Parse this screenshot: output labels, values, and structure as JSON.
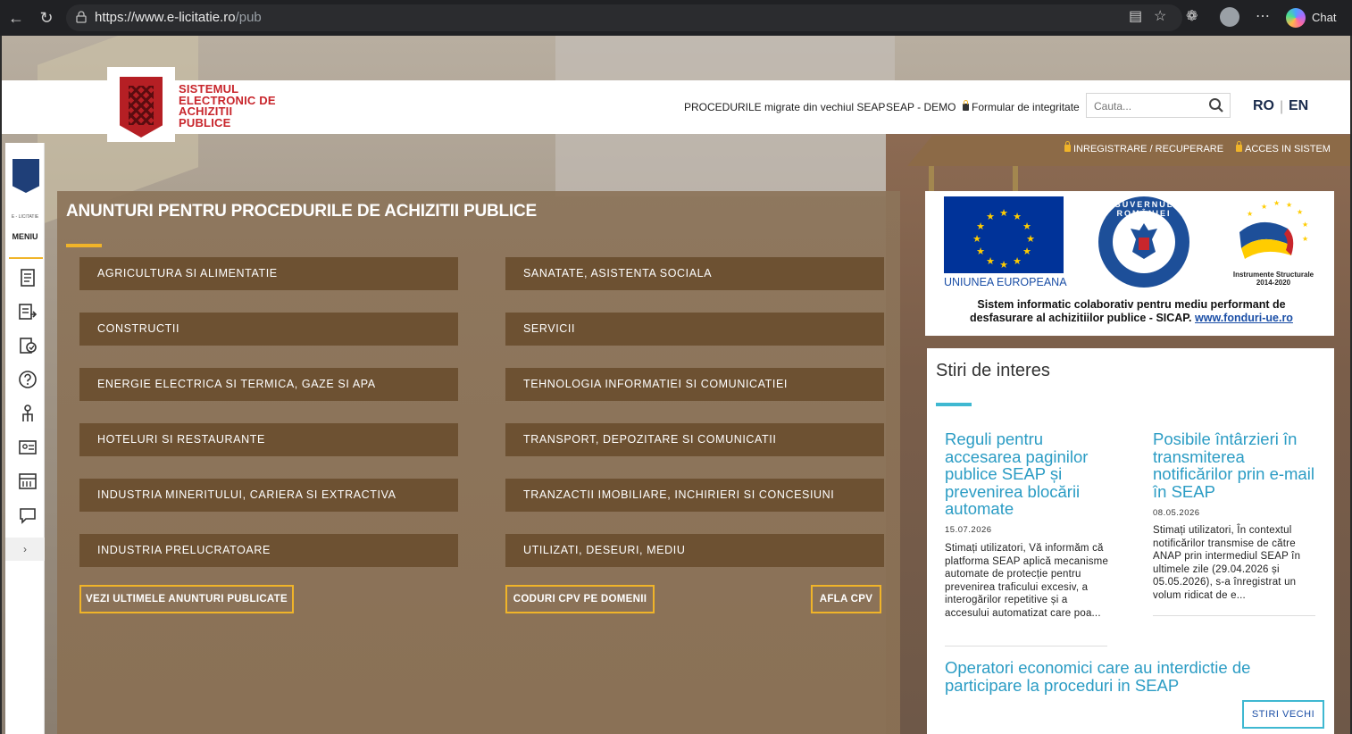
{
  "browser": {
    "url_host": "https://www.e-licitatie.ro",
    "url_path": "/pub",
    "chat_label": "Chat"
  },
  "header": {
    "logo_lines": [
      "SISTEMUL",
      "ELECTRONIC DE",
      "ACHIZITII",
      "PUBLICE"
    ],
    "links": {
      "proceduri": "PROCEDURILE migrate din vechiul SEAP",
      "demo": "SEAP - DEMO",
      "formular": "Formular de integritate"
    },
    "search_placeholder": "Cauta...",
    "lang_ro": "RO",
    "lang_sep": "|",
    "lang_en": "EN"
  },
  "login": {
    "register": "INREGISTRARE / RECUPERARE",
    "access": "ACCES IN SISTEM"
  },
  "sidebar": {
    "small_label": "E - LICITATIE",
    "menu_label": "MENIU",
    "expand": "›"
  },
  "main": {
    "title": "ANUNTURI PENTRU PROCEDURILE DE ACHIZITII PUBLICE",
    "categories_left": [
      "AGRICULTURA SI ALIMENTATIE",
      "CONSTRUCTII",
      "ENERGIE ELECTRICA SI TERMICA, GAZE SI APA",
      "HOTELURI SI RESTAURANTE",
      "INDUSTRIA MINERITULUI, CARIERA SI EXTRACTIVA",
      "INDUSTRIA PRELUCRATOARE"
    ],
    "categories_right": [
      "SANATATE, ASISTENTA SOCIALA",
      "SERVICII",
      "TEHNOLOGIA INFORMATIEI SI COMUNICATIEI",
      "TRANSPORT, DEPOZITARE SI COMUNICATII",
      "TRANZACTII IMOBILIARE, INCHIRIERI SI CONCESIUNI",
      "UTILIZATI, DESEURI, MEDIU"
    ],
    "btn_latest": "VEZI ULTIMELE ANUNTURI PUBLICATE",
    "btn_cpv_domains": "CODURI CPV PE DOMENII",
    "btn_afla_cpv": "AFLA CPV"
  },
  "eu": {
    "eu_label": "UNIUNEA EUROPEANA",
    "gov_text": "GUVERNUL ROMÂNIEI",
    "is_label_1": "Instrumente Structurale",
    "is_label_2": "2014-2020",
    "desc_1": "Sistem informatic colaborativ pentru mediu performant de",
    "desc_2": "desfasurare al achizitiilor publice - SICAP.",
    "desc_link": "www.fonduri-ue.ro"
  },
  "news": {
    "title": "Stiri de interes",
    "items": [
      {
        "headline": "Reguli pentru accesarea paginilor publice SEAP și prevenirea blocării automate",
        "date": "15.07.2026",
        "body": "Stimați utilizatori, Vă informăm că platforma SEAP aplică mecanisme automate de protecție pentru prevenirea traficului excesiv, a interogărilor repetitive și a accesului automatizat care poa..."
      },
      {
        "headline": "Posibile întârzieri în transmiterea notificărilor prin e-mail în SEAP",
        "date": "08.05.2026",
        "body": "Stimați utilizatori, În contextul notificărilor transmise de către ANAP prin intermediul SEAP în ultimele zile (29.04.2026 și 05.05.2026), s-a înregistrat un volum ridicat de e..."
      }
    ],
    "link": "Operatori economici care au interdictie de participare la proceduri in SEAP",
    "btn_old": "STIRI VECHI"
  },
  "colors": {
    "brand_red": "#c8262c",
    "gold": "#f0b429",
    "category_bg": "#6d5132",
    "news_blue": "#2b9cc4",
    "eu_blue": "#003399"
  }
}
